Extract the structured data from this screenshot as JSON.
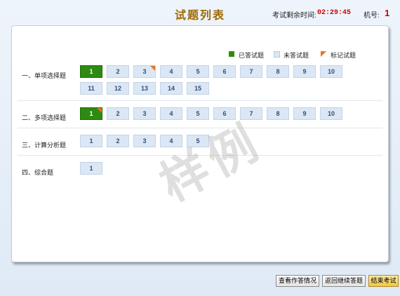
{
  "header": {
    "title": "试题列表",
    "timer_label": "考试剩余时间:",
    "timer_value": "02:29:45",
    "machine_label": "机号:",
    "machine_value": "1"
  },
  "legend": {
    "answered": "已答试题",
    "unanswered": "未答试题",
    "marked": "标记试题"
  },
  "sections": [
    {
      "label": "一、单项选择题",
      "questions": [
        {
          "n": "1",
          "state": "answered",
          "marked": false
        },
        {
          "n": "2",
          "state": "unanswered",
          "marked": false
        },
        {
          "n": "3",
          "state": "unanswered",
          "marked": true
        },
        {
          "n": "4",
          "state": "unanswered",
          "marked": false
        },
        {
          "n": "5",
          "state": "unanswered",
          "marked": false
        },
        {
          "n": "6",
          "state": "unanswered",
          "marked": false
        },
        {
          "n": "7",
          "state": "unanswered",
          "marked": false
        },
        {
          "n": "8",
          "state": "unanswered",
          "marked": false
        },
        {
          "n": "9",
          "state": "unanswered",
          "marked": false
        },
        {
          "n": "10",
          "state": "unanswered",
          "marked": false
        },
        {
          "n": "11",
          "state": "unanswered",
          "marked": false
        },
        {
          "n": "12",
          "state": "unanswered",
          "marked": false
        },
        {
          "n": "13",
          "state": "unanswered",
          "marked": false
        },
        {
          "n": "14",
          "state": "unanswered",
          "marked": false
        },
        {
          "n": "15",
          "state": "unanswered",
          "marked": false
        }
      ]
    },
    {
      "label": "二、多项选择题",
      "questions": [
        {
          "n": "1",
          "state": "answered",
          "marked": true
        },
        {
          "n": "2",
          "state": "unanswered",
          "marked": false
        },
        {
          "n": "3",
          "state": "unanswered",
          "marked": false
        },
        {
          "n": "4",
          "state": "unanswered",
          "marked": false
        },
        {
          "n": "5",
          "state": "unanswered",
          "marked": false
        },
        {
          "n": "6",
          "state": "unanswered",
          "marked": false
        },
        {
          "n": "7",
          "state": "unanswered",
          "marked": false
        },
        {
          "n": "8",
          "state": "unanswered",
          "marked": false
        },
        {
          "n": "9",
          "state": "unanswered",
          "marked": false
        },
        {
          "n": "10",
          "state": "unanswered",
          "marked": false
        }
      ]
    },
    {
      "label": "三、计算分析题",
      "questions": [
        {
          "n": "1",
          "state": "unanswered",
          "marked": false
        },
        {
          "n": "2",
          "state": "unanswered",
          "marked": false
        },
        {
          "n": "3",
          "state": "unanswered",
          "marked": false
        },
        {
          "n": "4",
          "state": "unanswered",
          "marked": false
        },
        {
          "n": "5",
          "state": "unanswered",
          "marked": false
        }
      ]
    },
    {
      "label": "四、综合题",
      "questions": [
        {
          "n": "1",
          "state": "unanswered",
          "marked": false
        }
      ]
    }
  ],
  "watermark": "样例",
  "footer": {
    "view_answers": "查看作答情况",
    "continue": "返回继续答题",
    "finish": "结束考试"
  },
  "colors": {
    "answered": "#2e8b12",
    "unanswered": "#dbe7f5",
    "marked": "#e8741e",
    "timer": "#d10000",
    "title": "#9a6a12"
  }
}
